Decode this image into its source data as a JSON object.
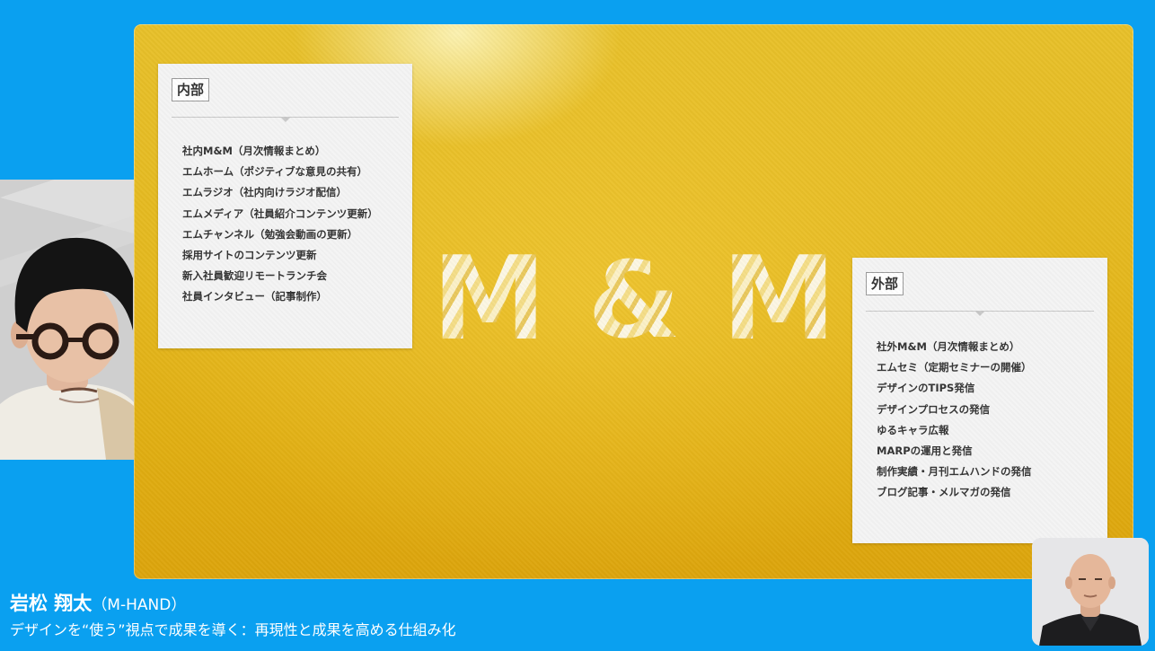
{
  "slide": {
    "logo": {
      "letter_1": "M",
      "ampersand": "&",
      "letter_2": "M"
    },
    "internal": {
      "label": "内部",
      "items": [
        "社内M&M（月次情報まとめ）",
        "エムホーム（ポジティブな意見の共有）",
        "エムラジオ（社内向けラジオ配信）",
        "エムメディア（社員紹介コンテンツ更新）",
        "エムチャンネル（勉強会動画の更新）",
        "採用サイトのコンテンツ更新",
        "新入社員歓迎リモートランチ会",
        "社員インタビュー（記事制作）"
      ]
    },
    "external": {
      "label": "外部",
      "items": [
        "社外M&M（月次情報まとめ）",
        "エムセミ（定期セミナーの開催）",
        "デザインのTIPS発信",
        "デザインプロセスの発信",
        "ゆるキャラ広報",
        "MARPの運用と発信",
        "制作実績・月刊エムハンドの発信",
        "ブログ記事・メルマガの発信"
      ]
    }
  },
  "caption": {
    "speaker_name": "岩松 翔太",
    "speaker_affiliation": "（M-HAND）",
    "talk_title": "デザインを“使う”視点で成果を導く：再現性と成果を高める仕組み化"
  },
  "colors": {
    "background": "#0aa0f0",
    "gold": "#e4b81e",
    "panel": "#f4f4f4",
    "text": "#333333"
  }
}
